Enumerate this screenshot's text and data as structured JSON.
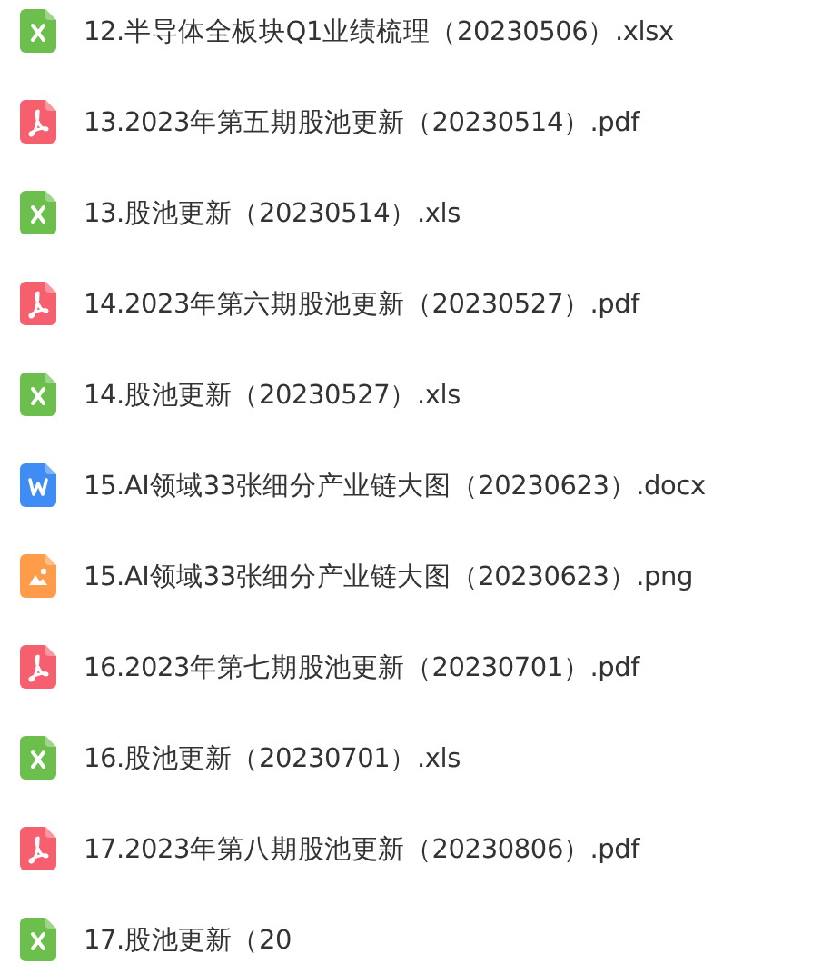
{
  "files": [
    {
      "kind": "spreadsheet",
      "name": "12.半导体全板块Q1业绩梳理（20230506）.xlsx"
    },
    {
      "kind": "pdf",
      "name": "13.2023年第五期股池更新（20230514）.pdf"
    },
    {
      "kind": "spreadsheet",
      "name": "13.股池更新（20230514）.xls"
    },
    {
      "kind": "pdf",
      "name": "14.2023年第六期股池更新（20230527）.pdf"
    },
    {
      "kind": "spreadsheet",
      "name": "14.股池更新（20230527）.xls"
    },
    {
      "kind": "document",
      "name": "15.AI领域33张细分产业链大图（20230623）.docx"
    },
    {
      "kind": "image",
      "name": "15.AI领域33张细分产业链大图（20230623）.png"
    },
    {
      "kind": "pdf",
      "name": "16.2023年第七期股池更新（20230701）.pdf"
    },
    {
      "kind": "spreadsheet",
      "name": "16.股池更新（20230701）.xls"
    },
    {
      "kind": "pdf",
      "name": "17.2023年第八期股池更新（20230806）.pdf"
    },
    {
      "kind": "spreadsheet",
      "name": "17.股池更新（20"
    }
  ]
}
